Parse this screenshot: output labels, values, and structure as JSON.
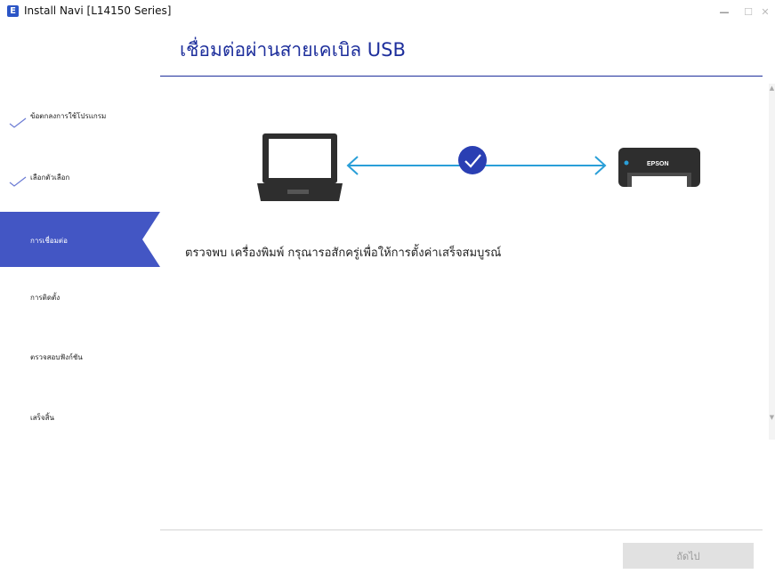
{
  "window": {
    "app_icon_letter": "E",
    "title": "Install Navi [L14150 Series]",
    "minimize_glyph": "—",
    "maximize_glyph": "☐",
    "close_glyph": "✕"
  },
  "header": {
    "title": "เชื่อมต่อผ่านสายเคเบิล USB"
  },
  "sidebar": {
    "steps": [
      {
        "label": "ข้อตกลงการใช้โปรแกรม",
        "state": "done"
      },
      {
        "label": "เลือกตัวเลือก",
        "state": "done"
      },
      {
        "label": "การเชื่อมต่อ",
        "state": "active"
      },
      {
        "label": "การติดตั้ง",
        "state": "pending"
      },
      {
        "label": "ตรวจสอบฟังก์ชัน",
        "state": "pending"
      },
      {
        "label": "เสร็จสิ้น",
        "state": "pending"
      }
    ]
  },
  "illustration": {
    "printer_brand": "EPSON",
    "connection_status": "connected"
  },
  "main": {
    "message": "ตรวจพบ เครื่องพิมพ์ กรุณารอสักครู่เพื่อให้การตั้งค่าเสร็จสมบูรณ์"
  },
  "footer": {
    "next_label": "ถัดไป"
  },
  "colors": {
    "accent": "#1e2f9c",
    "sidebar_active": "#4356c4",
    "arrow": "#2a9fd8",
    "check_circle": "#2a3fb3"
  }
}
